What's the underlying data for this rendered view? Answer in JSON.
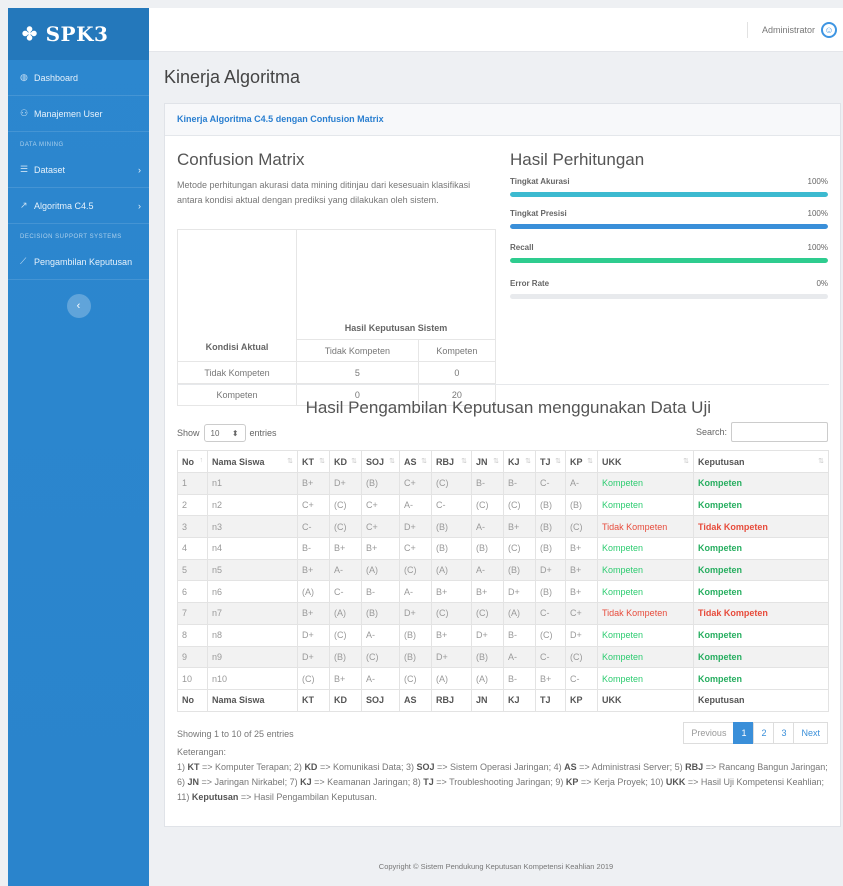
{
  "sidebar": {
    "brand": "SPK3",
    "items": [
      {
        "label": "Dashboard",
        "icon": "dashboard-icon",
        "glyph": "◍"
      },
      {
        "label": "Manajemen User",
        "icon": "users-icon",
        "glyph": "⚇"
      }
    ],
    "section1": "DATA MINING",
    "dm_items": [
      {
        "label": "Dataset",
        "icon": "list-icon",
        "glyph": "☰"
      },
      {
        "label": "Algoritma C4.5",
        "icon": "chart-icon",
        "glyph": "↗"
      }
    ],
    "section2": "DECISION SUPPORT SYSTEMS",
    "dss_items": [
      {
        "label": "Pengambilan Keputusan",
        "icon": "line-chart-icon",
        "glyph": "⟋"
      }
    ],
    "collapse_glyph": "‹"
  },
  "topbar": {
    "user": "Administrator"
  },
  "page": {
    "title": "Kinerja Algoritma"
  },
  "card": {
    "header": "Kinerja Algoritma C4.5 dengan Confusion Matrix",
    "confusion": {
      "title": "Confusion Matrix",
      "desc": "Metode perhitungan akurasi data mining ditinjau dari kesesuain klasifikasi antara kondisi aktual dengan prediksi yang dilakukan oleh sistem.",
      "row_header": "Kondisi Aktual",
      "col_header": "Hasil Keputusan Sistem",
      "cols": [
        "Tidak Kompeten",
        "Kompeten"
      ],
      "rows": [
        {
          "label": "Tidak Kompeten",
          "values": [
            "5",
            "0"
          ]
        },
        {
          "label": "Kompeten",
          "values": [
            "0",
            "20"
          ]
        }
      ]
    },
    "hasil": {
      "title": "Hasil Perhitungan",
      "metrics": [
        {
          "label": "Tingkat Akurasi",
          "value": "100%",
          "fill": 1.0,
          "color": "#3cbad0"
        },
        {
          "label": "Tingkat Presisi",
          "value": "100%",
          "fill": 1.0,
          "color": "#3a8fd9"
        },
        {
          "label": "Recall",
          "value": "100%",
          "fill": 1.0,
          "color": "#2ecc8f"
        },
        {
          "label": "Error Rate",
          "value": "0%",
          "fill": 0.0,
          "color": "#e74c3c"
        }
      ]
    },
    "table": {
      "title": "Hasil Pengambilan Keputusan menggunakan Data Uji",
      "show_label": "Show",
      "entries_value": "10",
      "entries_label": "entries",
      "search_label": "Search:",
      "columns": [
        "No",
        "Nama Siswa",
        "KT",
        "KD",
        "SOJ",
        "AS",
        "RBJ",
        "JN",
        "KJ",
        "TJ",
        "KP",
        "UKK",
        "Keputusan"
      ],
      "rows": [
        [
          "1",
          "n1",
          "B+",
          "D+",
          "(B)",
          "C+",
          "(C)",
          "B-",
          "B-",
          "C-",
          "A-",
          "Kompeten",
          "Kompeten"
        ],
        [
          "2",
          "n2",
          "C+",
          "(C)",
          "C+",
          "A-",
          "C-",
          "(C)",
          "(C)",
          "(B)",
          "(B)",
          "Kompeten",
          "Kompeten"
        ],
        [
          "3",
          "n3",
          "C-",
          "(C)",
          "C+",
          "D+",
          "(B)",
          "A-",
          "B+",
          "(B)",
          "(C)",
          "Tidak Kompeten",
          "Tidak Kompeten"
        ],
        [
          "4",
          "n4",
          "B-",
          "B+",
          "B+",
          "C+",
          "(B)",
          "(B)",
          "(C)",
          "(B)",
          "B+",
          "Kompeten",
          "Kompeten"
        ],
        [
          "5",
          "n5",
          "B+",
          "A-",
          "(A)",
          "(C)",
          "(A)",
          "A-",
          "(B)",
          "D+",
          "B+",
          "Kompeten",
          "Kompeten"
        ],
        [
          "6",
          "n6",
          "(A)",
          "C-",
          "B-",
          "A-",
          "B+",
          "B+",
          "D+",
          "(B)",
          "B+",
          "Kompeten",
          "Kompeten"
        ],
        [
          "7",
          "n7",
          "B+",
          "(A)",
          "(B)",
          "D+",
          "(C)",
          "(C)",
          "(A)",
          "C-",
          "C+",
          "Tidak Kompeten",
          "Tidak Kompeten"
        ],
        [
          "8",
          "n8",
          "D+",
          "(C)",
          "A-",
          "(B)",
          "B+",
          "D+",
          "B-",
          "(C)",
          "D+",
          "Kompeten",
          "Kompeten"
        ],
        [
          "9",
          "n9",
          "D+",
          "(B)",
          "(C)",
          "(B)",
          "D+",
          "(B)",
          "A-",
          "C-",
          "(C)",
          "Kompeten",
          "Kompeten"
        ],
        [
          "10",
          "n10",
          "(C)",
          "B+",
          "A-",
          "(C)",
          "(A)",
          "(A)",
          "B-",
          "B+",
          "C-",
          "Kompeten",
          "Kompeten"
        ]
      ],
      "info": "Showing 1 to 10 of 25 entries",
      "pager": {
        "prev": "Previous",
        "pages": [
          "1",
          "2",
          "3"
        ],
        "next": "Next"
      }
    },
    "keterangan": {
      "label": "Keterangan:",
      "items": [
        [
          "1) ",
          "KT",
          " => Komputer Terapan; "
        ],
        [
          "2) ",
          "KD",
          " => Komunikasi Data; "
        ],
        [
          "3) ",
          "SOJ",
          " => Sistem Operasi Jaringan; "
        ],
        [
          "4) ",
          "AS",
          " => Administrasi Server; "
        ],
        [
          "5) ",
          "RBJ",
          " => Rancang Bangun Jaringan; "
        ],
        [
          "6) ",
          "JN",
          " => Jaringan Nirkabel; "
        ],
        [
          "7) ",
          "KJ",
          " => Keamanan Jaringan; "
        ],
        [
          "8) ",
          "TJ",
          " => Troubleshooting Jaringan; "
        ],
        [
          "9) ",
          "KP",
          " => Kerja Proyek; "
        ],
        [
          "10) ",
          "UKK",
          " => Hasil Uji Kompetensi Keahlian; "
        ],
        [
          "11) ",
          "Keputusan",
          " => Hasil Pengambilan Keputusan."
        ]
      ]
    }
  },
  "footer": "Copyright © Sistem Pendukung Keputusan Kompetensi Keahlian 2019"
}
